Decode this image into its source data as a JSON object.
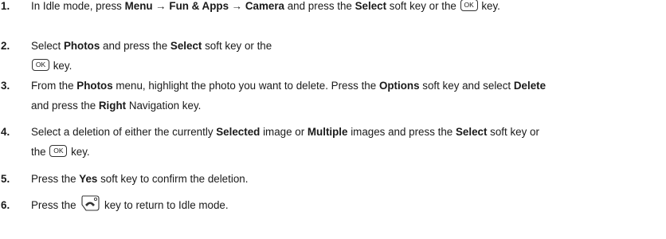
{
  "steps": [
    {
      "number": "1.",
      "lines": [
        [
          "In Idle mode, press ",
          {
            "b": "Menu → Fun & Apps → Camera"
          },
          " and press the ",
          {
            "b": "Select"
          },
          " soft key or the ",
          {
            "key": "OK"
          },
          " key."
        ]
      ]
    },
    {
      "number": "2.",
      "lines": [
        [
          "Select ",
          {
            "b": "Photos"
          },
          " and press the ",
          {
            "b": "Select"
          },
          " soft key or the"
        ],
        [
          {
            "key": "OK"
          },
          " key."
        ]
      ]
    },
    {
      "number": "3.",
      "lines": [
        [
          "From the ",
          {
            "b": "Photos"
          },
          " menu, highlight the photo you want to delete. Press the ",
          {
            "b": "Options"
          },
          " soft key and select ",
          {
            "b": "Delete"
          }
        ],
        [
          "and press the ",
          {
            "b": "Right"
          },
          " Navigation key."
        ]
      ]
    },
    {
      "number": "4.",
      "lines": [
        [
          "Select a deletion of either the currently ",
          {
            "b": "Selected"
          },
          " image or ",
          {
            "b": "Multiple"
          },
          " images and press the ",
          {
            "b": "Select"
          },
          " soft key or"
        ],
        [
          "the ",
          {
            "key": "OK"
          },
          " key."
        ]
      ]
    },
    {
      "number": "5.",
      "lines": [
        [
          "Press the ",
          {
            "b": "Yes"
          },
          " soft key to confirm the deletion."
        ]
      ]
    },
    {
      "number": "6.",
      "lines": [
        [
          "Press the ",
          {
            "icon": "end-key-icon"
          },
          " key to return to Idle mode."
        ]
      ]
    }
  ]
}
